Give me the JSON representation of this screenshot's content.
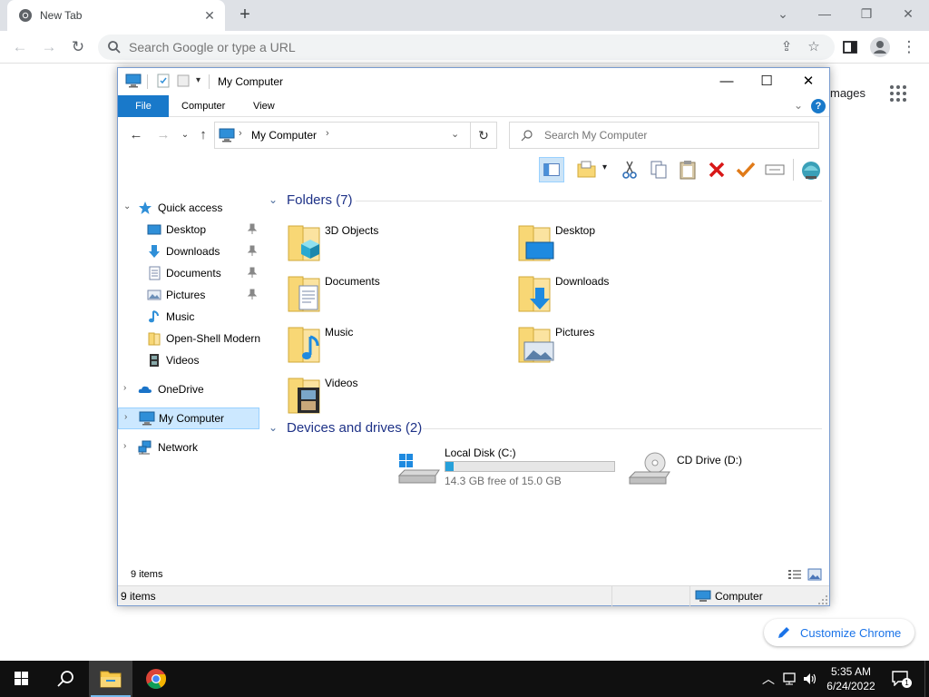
{
  "chrome": {
    "tab_title": "New Tab",
    "omnibox_placeholder": "Search Google or type a URL",
    "images_link": "mages",
    "customize_label": "Customize Chrome"
  },
  "explorer": {
    "title": "My Computer",
    "ribbon_tabs": [
      "File",
      "Computer",
      "View"
    ],
    "address_text": "My Computer",
    "search_placeholder": "Search My Computer",
    "nav": {
      "quick_access": "Quick access",
      "quick_items": [
        "Desktop",
        "Downloads",
        "Documents",
        "Pictures",
        "Music",
        "Open-Shell Modern",
        "Videos"
      ],
      "onedrive": "OneDrive",
      "my_computer": "My Computer",
      "network": "Network"
    },
    "folders_header": "Folders (7)",
    "folders": [
      "3D Objects",
      "Desktop",
      "Documents",
      "Downloads",
      "Music",
      "Pictures",
      "Videos"
    ],
    "devices_header": "Devices and drives (2)",
    "drives": [
      {
        "name": "Local Disk (C:)",
        "free_text": "14.3 GB free of 15.0 GB",
        "used_fraction": 0.047
      },
      {
        "name": "CD Drive (D:)"
      }
    ],
    "footer_count": "9 items",
    "status_count": "9 items",
    "status_location": "Computer"
  },
  "taskbar": {
    "time": "5:35 AM",
    "date": "6/24/2022",
    "notification_count": "1"
  },
  "colors": {
    "accent": "#1979ca",
    "folder_yellow": "#f8d775",
    "progress": "#26a0da"
  }
}
